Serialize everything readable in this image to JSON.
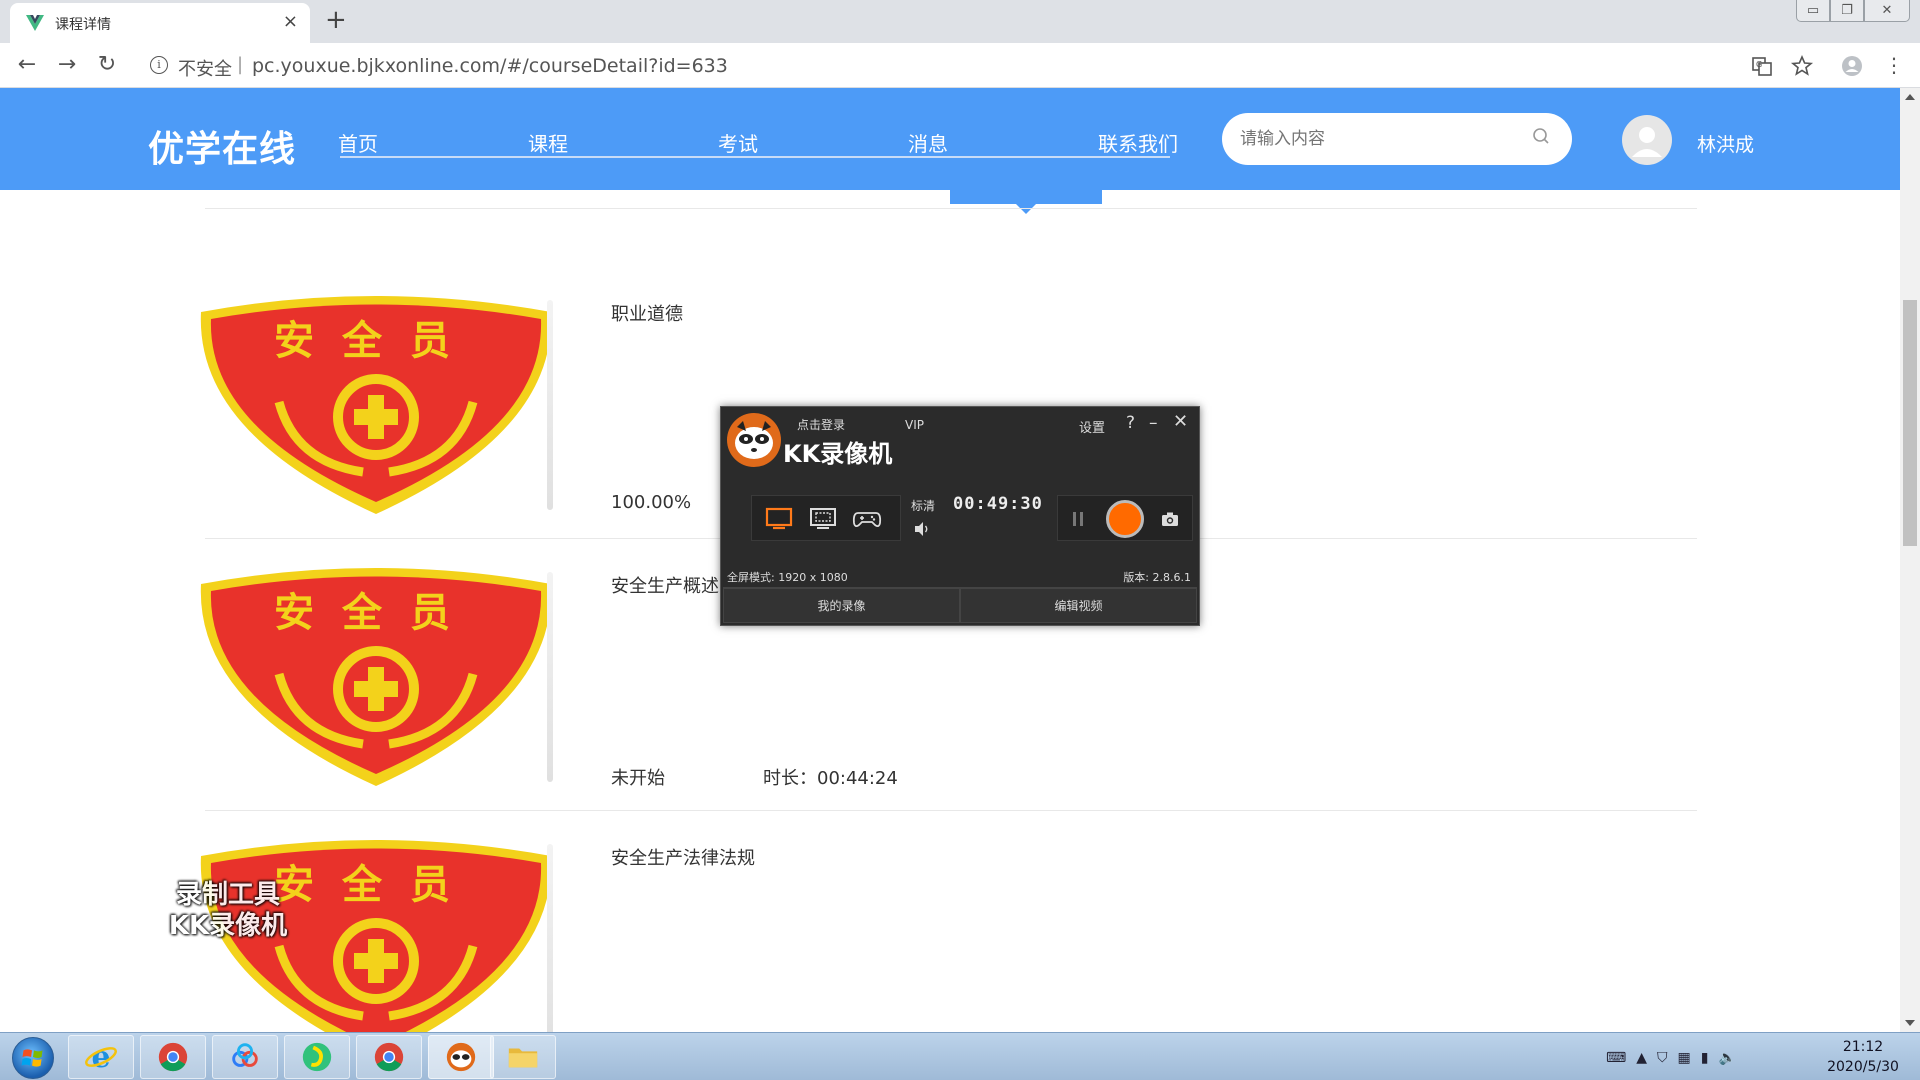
{
  "browser": {
    "tab_title": "课程详情",
    "new_tab": "+",
    "tab_close": "×",
    "security_label": "不安全",
    "url": "pc.youxue.bjkxonline.com/#/courseDetail?id=633"
  },
  "site": {
    "logo": "优学在线",
    "nav": [
      "首页",
      "课程",
      "考试",
      "消息",
      "联系我们"
    ],
    "search_placeholder": "请输入内容",
    "username": "林洪成",
    "accent_color": "#4d9bf7"
  },
  "courses": [
    {
      "name": "职业道德",
      "status": "100.00%",
      "duration": ""
    },
    {
      "name": "安全生产概述",
      "status": "未开始",
      "duration": "时长：00:44:24"
    },
    {
      "name": "安全生产法律法规",
      "status": "",
      "duration": ""
    }
  ],
  "badge": {
    "text": "安全员",
    "red": "#e8322b",
    "yellow": "#f3d21b"
  },
  "recorder": {
    "login": "点击登录",
    "vip": "VIP",
    "brand": "KK录像机",
    "settings": "设置",
    "help": "?",
    "minimize": "–",
    "close": "✕",
    "quality": "标清",
    "timer": "00:49:30",
    "mode_text": "全屏模式: 1920 x 1080",
    "version": "版本: 2.8.6.1",
    "btn_my_recordings": "我的录像",
    "btn_edit_video": "编辑视频"
  },
  "watermark": {
    "line1": "录制工具",
    "line2": "KK录像机"
  },
  "taskbar": {
    "time": "21:12",
    "date": "2020/5/30"
  }
}
